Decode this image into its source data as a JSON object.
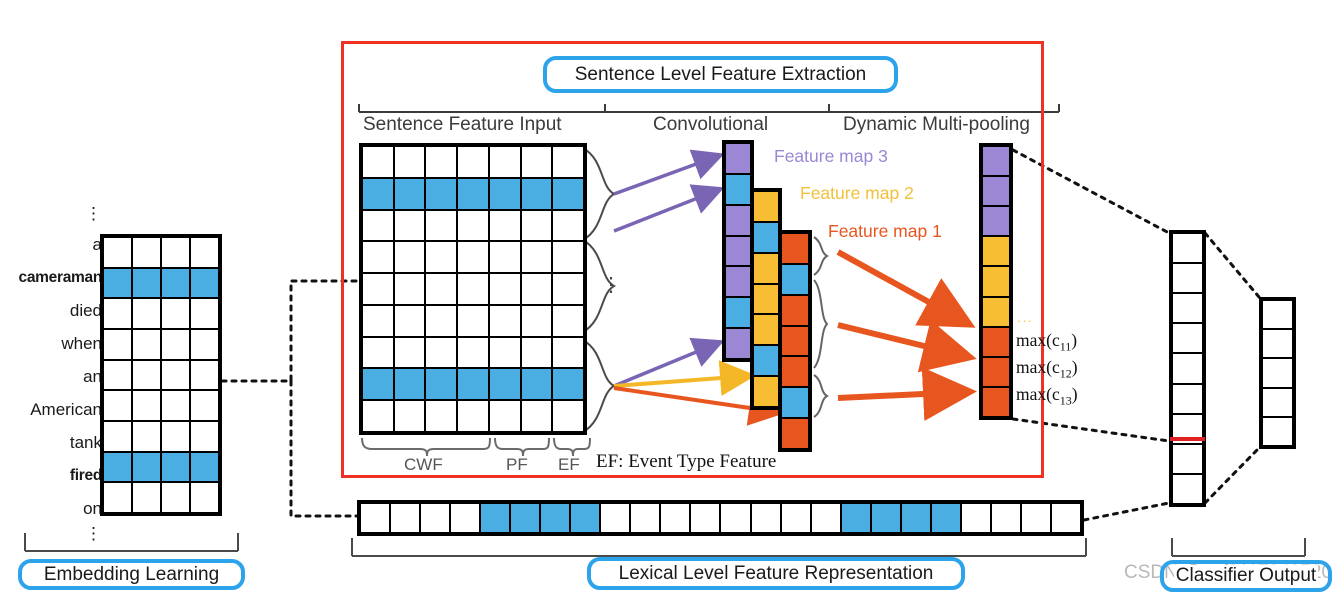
{
  "figure": {
    "title_panel": "Sentence Level Feature Extraction",
    "lexical_label": "Lexical Level Feature Representation",
    "embedding_label": "Embedding Learning",
    "classifier_label": "Classifier Output",
    "watermark": "CSDN @zaf21172437201",
    "ef_note": "EF: Event Type Feature"
  },
  "sections": {
    "sentence_feature_input": "Sentence Feature Input",
    "convolutional": "Convolutional",
    "dynamic_multi_pooling": "Dynamic Multi-pooling"
  },
  "sentence": {
    "ellipsis_top": "⋮",
    "ellipsis_bottom": "⋮",
    "words": [
      {
        "text": "a",
        "bold": false,
        "highlight": false
      },
      {
        "text": "cameraman",
        "bold": true,
        "highlight": true
      },
      {
        "text": "died",
        "bold": false,
        "highlight": false
      },
      {
        "text": "when",
        "bold": false,
        "highlight": false
      },
      {
        "text": "an",
        "bold": false,
        "highlight": false
      },
      {
        "text": "American",
        "bold": false,
        "highlight": false
      },
      {
        "text": "tank",
        "bold": false,
        "highlight": false
      },
      {
        "text": "fired",
        "bold": true,
        "highlight": true
      },
      {
        "text": "on",
        "bold": false,
        "highlight": false
      }
    ]
  },
  "embedding_grid": {
    "rows": 9,
    "cols": 4,
    "highlighted_rows": [
      2,
      8
    ]
  },
  "sentence_grid": {
    "rows": 9,
    "cols": 7,
    "highlighted_rows": [
      2,
      8
    ],
    "ellipsis": "⋮",
    "brace_labels": [
      {
        "text": "CWF",
        "cols": 4
      },
      {
        "text": "PF",
        "cols": 2
      },
      {
        "text": "EF",
        "cols": 1
      }
    ]
  },
  "feature_maps": [
    {
      "name": "Feature map 3",
      "color": "#9b87d4",
      "cells": [
        "purple",
        "blue",
        "purple",
        "purple",
        "purple",
        "blue",
        "purple"
      ]
    },
    {
      "name": "Feature map 2",
      "color": "#f2c03a",
      "cells": [
        "yellow",
        "blue",
        "yellow",
        "yellow",
        "yellow",
        "blue",
        "yellow"
      ]
    },
    {
      "name": "Feature map 1",
      "color": "#e8561f",
      "cells": [
        "orange",
        "blue",
        "orange",
        "orange",
        "orange",
        "blue",
        "orange"
      ]
    }
  ],
  "pooling_column": {
    "cells": [
      "purple",
      "purple",
      "purple",
      "yellow",
      "yellow",
      "yellow",
      "orange",
      "orange",
      "orange"
    ],
    "dots": "···",
    "labels": [
      "max(c",
      "max(c",
      "max(c"
    ],
    "label_subs": [
      "11",
      "12",
      "13"
    ]
  },
  "lexical_bar": {
    "total_cells": 24,
    "pattern": [
      "w",
      "w",
      "w",
      "w",
      "b",
      "b",
      "b",
      "b",
      "w",
      "w",
      "w",
      "w",
      "w",
      "w",
      "w",
      "w",
      "b",
      "b",
      "b",
      "b",
      "w",
      "w",
      "w",
      "w"
    ]
  },
  "classifier": {
    "hidden_cells": 9,
    "separator_after_cell": 7,
    "separator_color": "#e02020",
    "output_cells": 5
  },
  "colors": {
    "blue": "#4aaee2",
    "purple": "#9b87d4",
    "yellow": "#f7bd33",
    "orange": "#e8561f",
    "panel_border": "#ef3124",
    "pill_border": "#2da3ec"
  }
}
